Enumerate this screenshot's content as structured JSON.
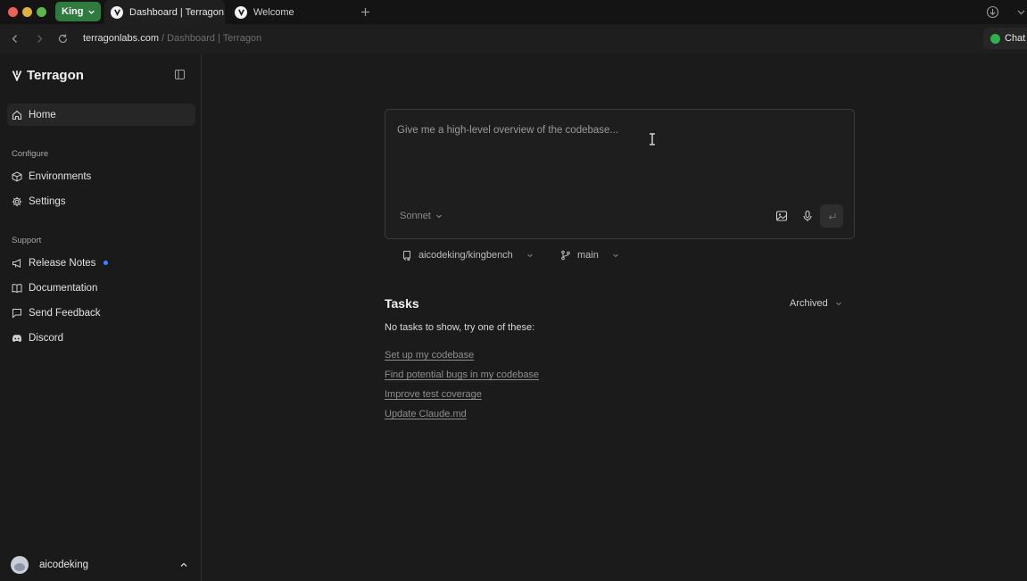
{
  "browser": {
    "profile_label": "King",
    "tabs": [
      {
        "title": "Dashboard | Terragon",
        "active": true
      },
      {
        "title": "Welcome",
        "active": false
      }
    ],
    "url_domain": "terragonlabs.com",
    "url_path": " / Dashboard | Terragon",
    "chat_label": "Chat"
  },
  "sidebar": {
    "brand": "Terragon",
    "home_label": "Home",
    "configure_label": "Configure",
    "configure_items": [
      {
        "label": "Environments",
        "icon": "environments-icon"
      },
      {
        "label": "Settings",
        "icon": "gear-icon"
      }
    ],
    "support_label": "Support",
    "support_items": [
      {
        "label": "Release Notes",
        "icon": "megaphone-icon",
        "badge": true
      },
      {
        "label": "Documentation",
        "icon": "book-icon"
      },
      {
        "label": "Send Feedback",
        "icon": "message-icon"
      },
      {
        "label": "Discord",
        "icon": "discord-icon"
      }
    ],
    "user_name": "aicodeking"
  },
  "composer": {
    "prompt_value": "Give me a high-level overview of the codebase...",
    "model": "Sonnet",
    "repo": "aicodeking/kingbench",
    "branch": "main"
  },
  "tasks": {
    "title": "Tasks",
    "filter": "Archived",
    "empty_message": "No tasks to show, try one of these:",
    "suggestions": [
      "Set up my codebase",
      "Find potential bugs in my codebase",
      "Improve test coverage",
      "Update Claude.md"
    ]
  },
  "colors": {
    "profile_badge": "#2f7a3e",
    "chat_dot": "#2eb14d",
    "notification_dot": "#3a86ff",
    "background": "#1b1b1b"
  }
}
